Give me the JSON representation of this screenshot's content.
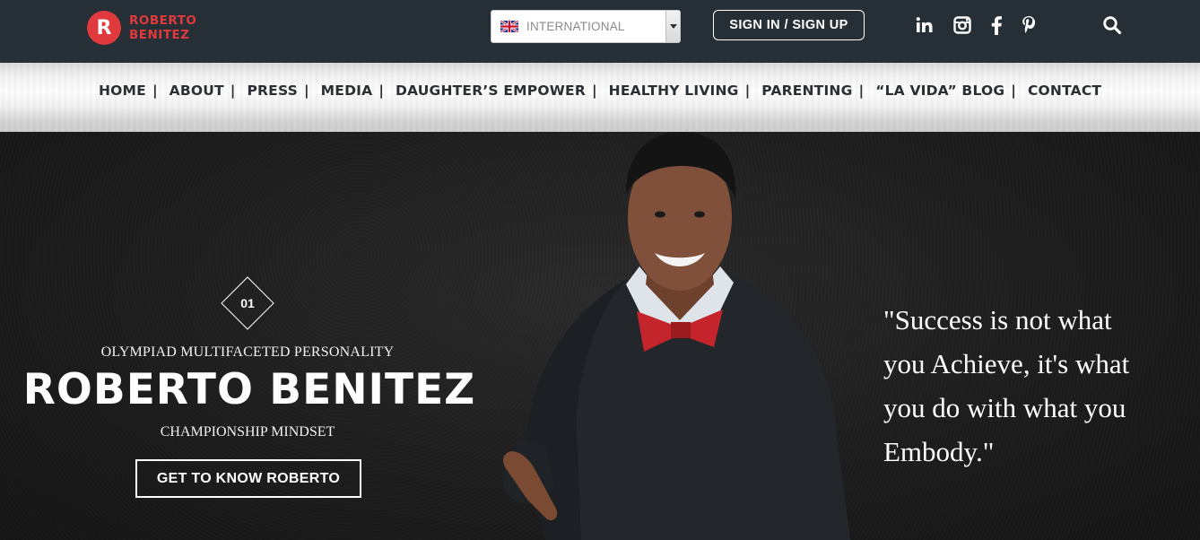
{
  "brand": {
    "mark": "R",
    "line1": "ROBERTO",
    "line2": "BENITEZ",
    "color": "#e0393e"
  },
  "header": {
    "language": {
      "selected": "INTERNATIONAL",
      "flag_icon": "uk-flag-icon"
    },
    "signin_label": "SIGN IN / SIGN UP",
    "social_icons": [
      "linkedin-icon",
      "instagram-icon",
      "facebook-icon",
      "pinterest-icon",
      "search-icon"
    ],
    "background": "#262f35"
  },
  "nav": {
    "items": [
      {
        "label": "HOME"
      },
      {
        "label": "ABOUT"
      },
      {
        "label": "PRESS"
      },
      {
        "label": "MEDIA"
      },
      {
        "label": "DAUGHTER’S EMPOWER"
      },
      {
        "label": "HEALTHY LIVING"
      },
      {
        "label": "PARENTING"
      },
      {
        "label": "“LA VIDA” BLOG"
      },
      {
        "label": "CONTACT"
      }
    ],
    "separator": "|"
  },
  "hero": {
    "slide_number": "01",
    "kicker": "OLYMPIAD MULTIFACETED PERSONALITY",
    "title": "ROBERTO BENITEZ",
    "subkicker": "CHAMPIONSHIP MINDSET",
    "cta_label": "GET TO KNOW ROBERTO",
    "quote_lines": [
      "\"Success is not what",
      "you Achieve, it's what",
      "you do with what you",
      "Embody.\""
    ]
  }
}
